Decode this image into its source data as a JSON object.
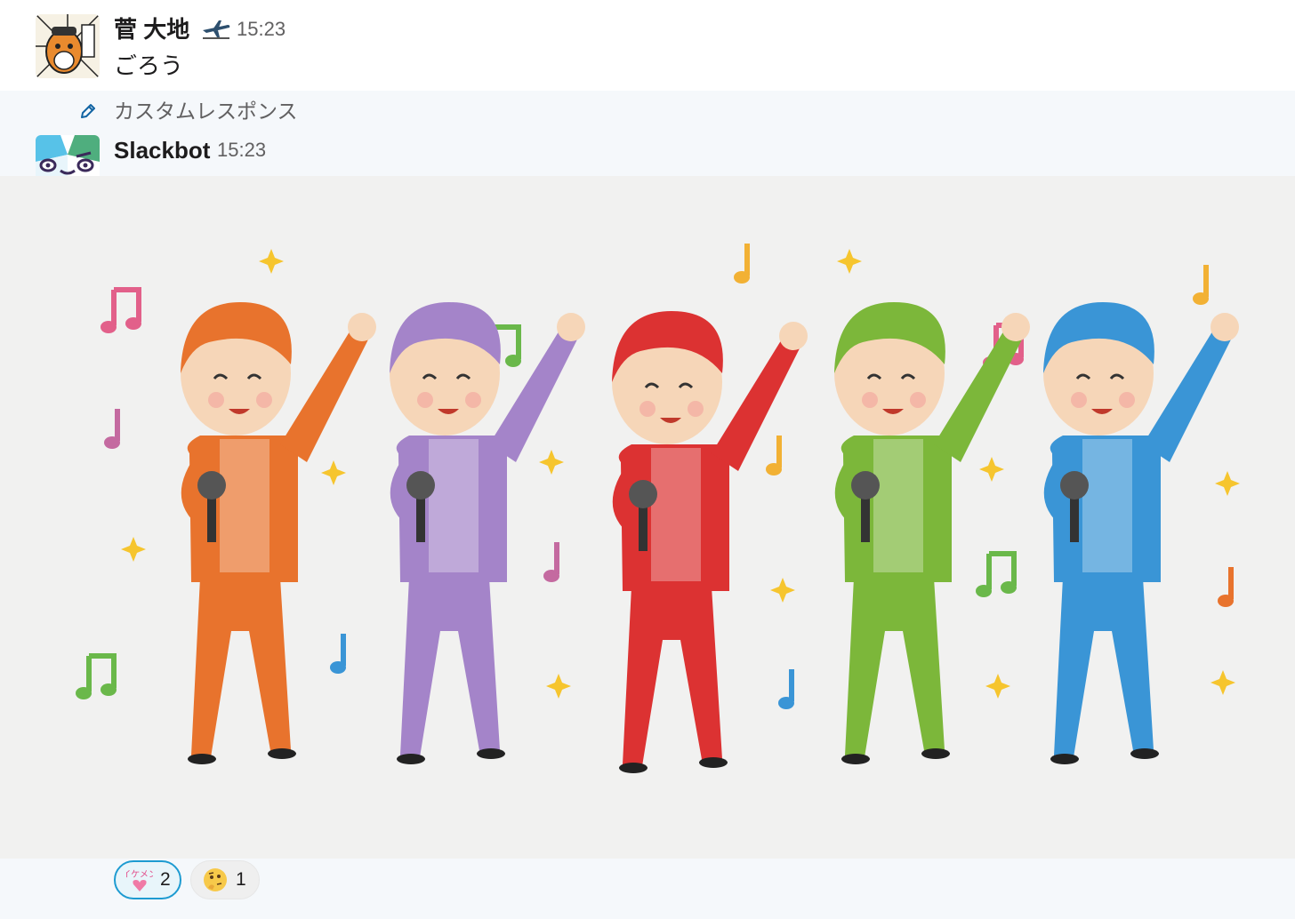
{
  "message1": {
    "sender": "菅 大地",
    "status_icon": "airplane-icon",
    "time": "15:23",
    "text": "ごろう"
  },
  "message2": {
    "label_icon": "pencil-icon",
    "label": "カスタムレスポンス",
    "sender": "Slackbot",
    "time": "15:23",
    "image_description_icon": "idol-group-singing-illustration"
  },
  "reactions": [
    {
      "emoji": "ikemen-emoji",
      "emoji_text": "イケメン",
      "count": "2",
      "active": true
    },
    {
      "emoji": "thinking-face-emoji",
      "count": "1",
      "active": false
    }
  ],
  "colors": {
    "accent": "#1d9bd1",
    "meta_text": "#616061",
    "panel_bg": "#f5f8fb",
    "members": [
      "#e8732d",
      "#a484c9",
      "#dc3232",
      "#7cb73a",
      "#3a95d6"
    ]
  }
}
